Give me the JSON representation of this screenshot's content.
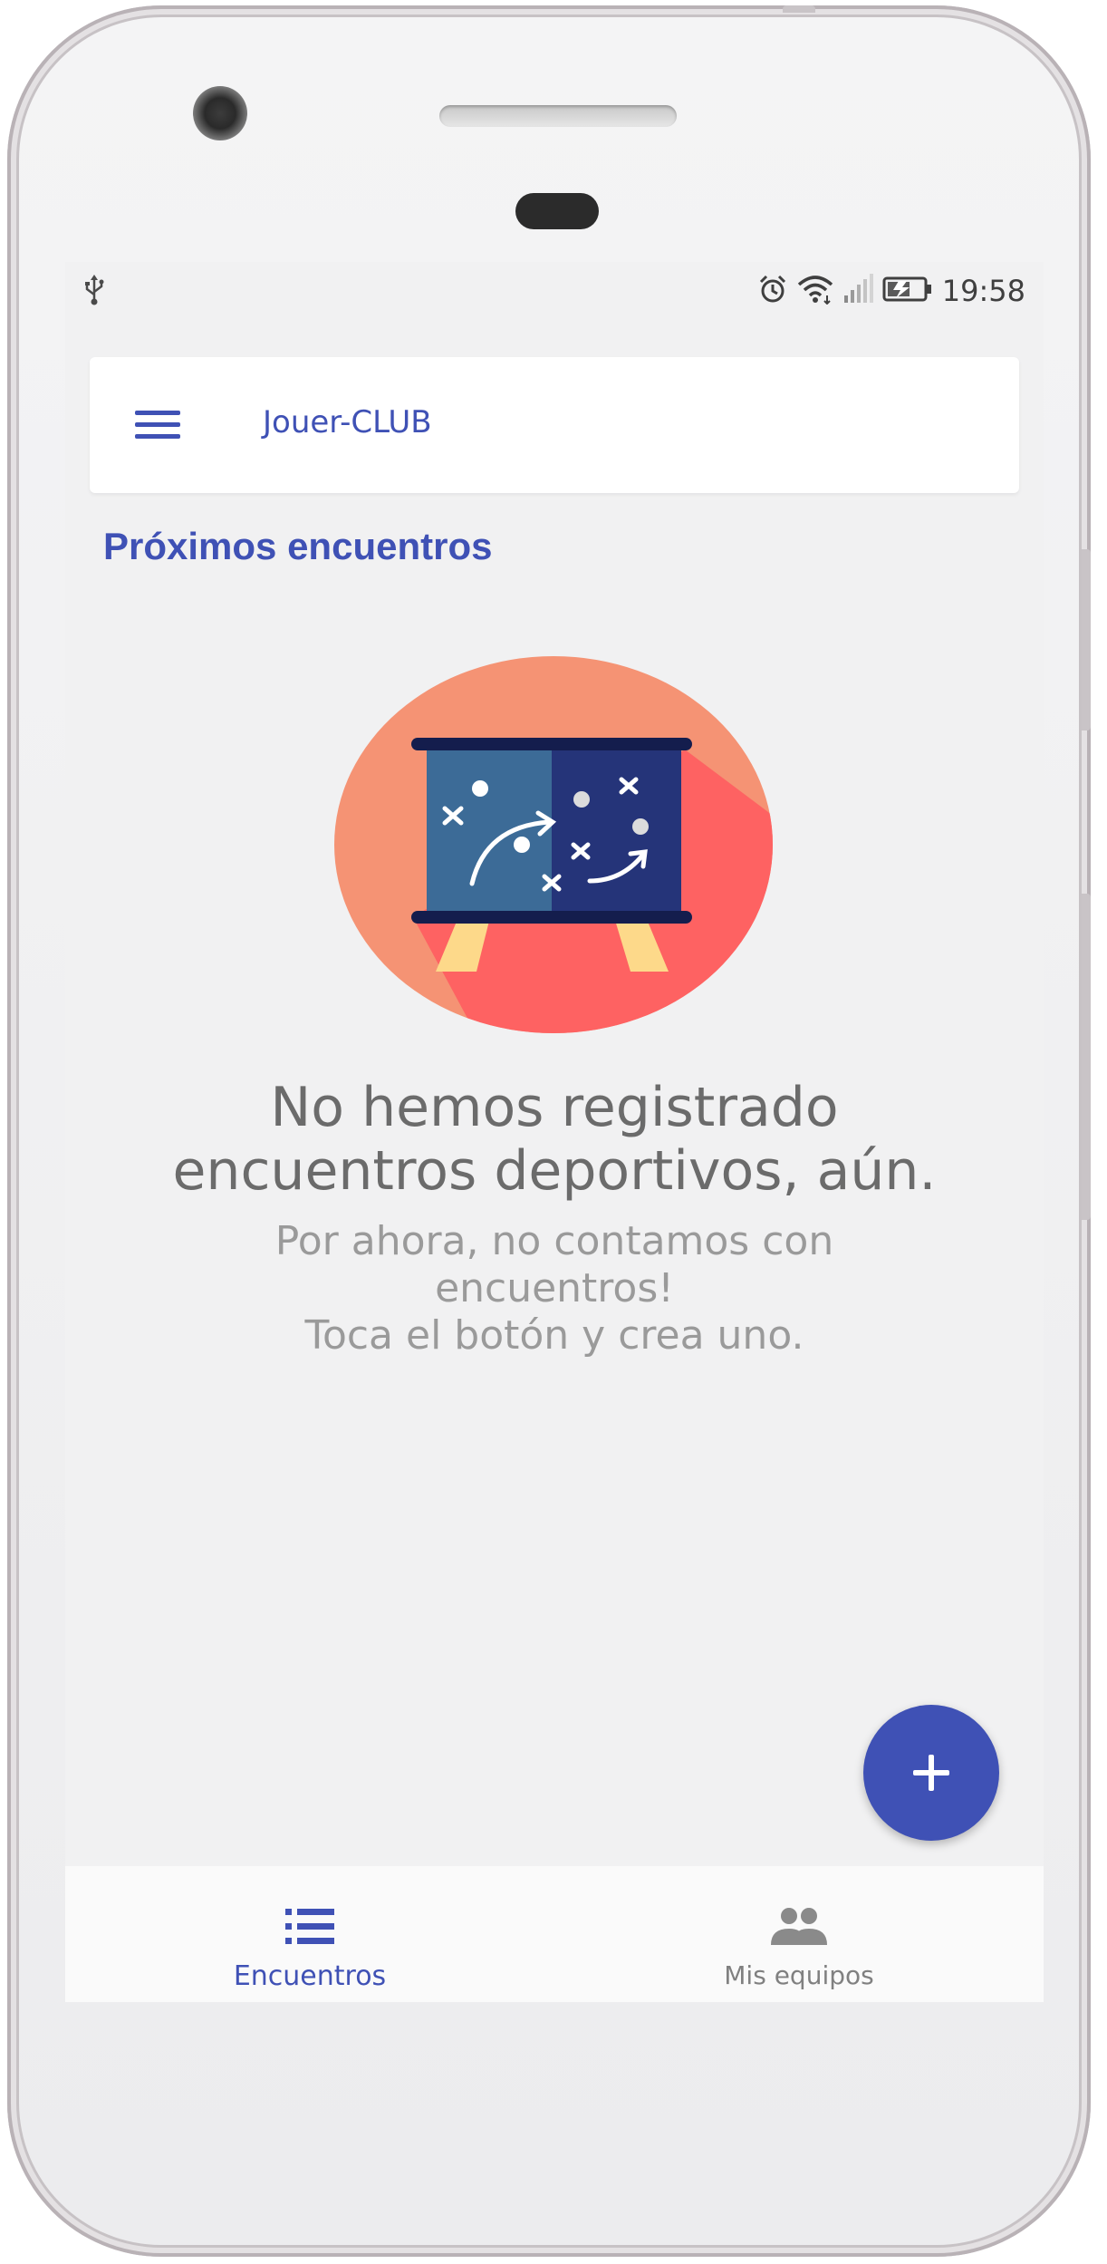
{
  "status_bar": {
    "time": "19:58",
    "left_icons": [
      "usb-icon"
    ],
    "right_icons": [
      "alarm-icon",
      "wifi-icon",
      "signal-icon",
      "battery-icon"
    ]
  },
  "app_bar": {
    "title": "Jouer-CLUB",
    "menu_icon": "hamburger-menu-icon"
  },
  "section": {
    "title": "Próximos encuentros"
  },
  "empty_state": {
    "illustration": "tactics-board-illustration",
    "title_line1": "No hemos registrado",
    "title_line2": "encuentros deportivos, aún.",
    "sub_line1": "Por ahora, no contamos con",
    "sub_line2": "encuentros!",
    "sub_line3": "Toca el botón y crea uno."
  },
  "fab": {
    "icon": "plus-icon"
  },
  "bottom_nav": {
    "items": [
      {
        "label": "Encuentros",
        "icon": "list-icon",
        "active": true
      },
      {
        "label": "Mis equipos",
        "icon": "group-icon",
        "active": false
      }
    ]
  },
  "colors": {
    "primary": "#3f51b5",
    "background": "#f1f1f2",
    "illustration_circle": "#f59374",
    "illustration_shadow": "#fe6262",
    "board_light": "#3c6b97",
    "board_dark": "#253479"
  }
}
